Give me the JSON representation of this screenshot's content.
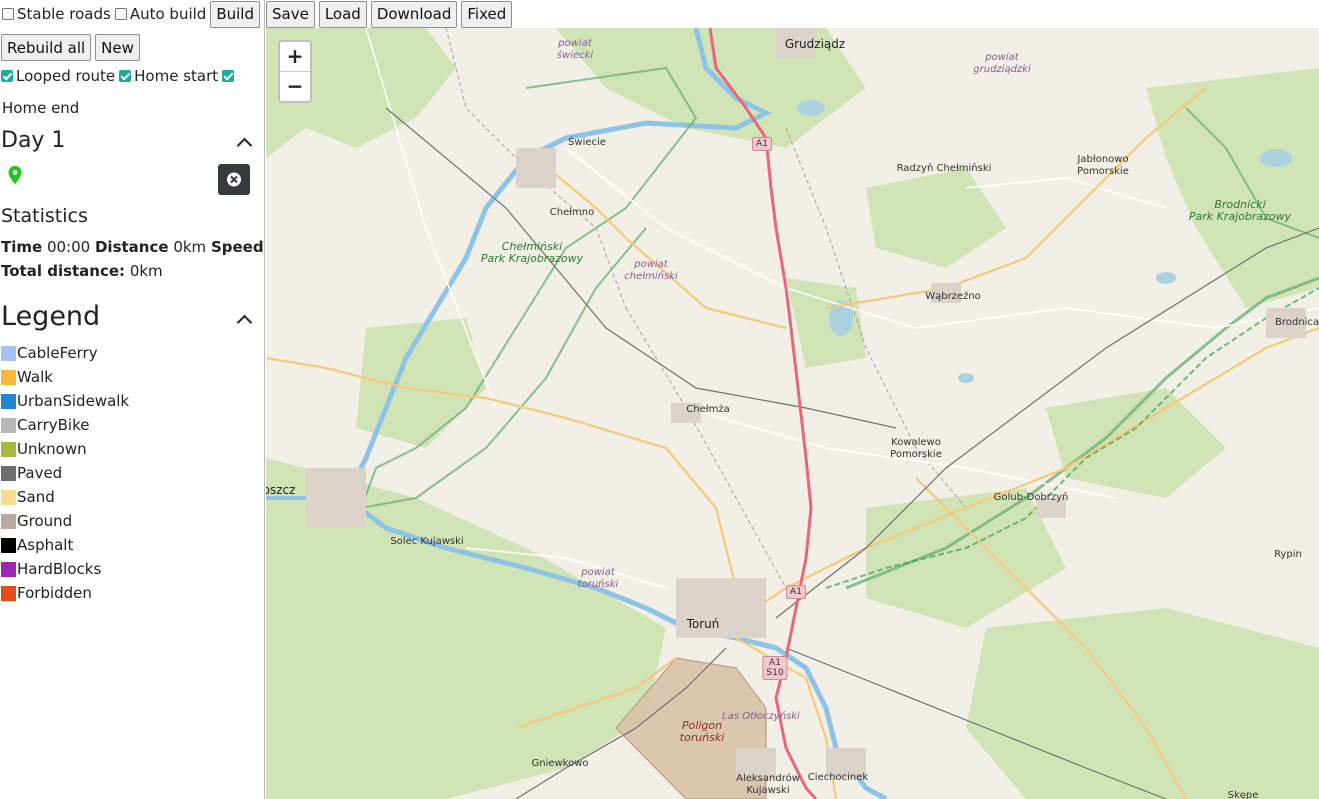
{
  "toolbar": {
    "stable_roads": "Stable roads",
    "auto_build": "Auto build",
    "build": "Build",
    "save": "Save",
    "load": "Load",
    "download": "Download",
    "fixed": "Fixed",
    "rebuild_all": "Rebuild all",
    "new": "New"
  },
  "options": {
    "looped_route": "Looped route",
    "home_start": "Home start",
    "home_end": "Home end"
  },
  "day": {
    "title": "Day 1"
  },
  "statistics": {
    "title": "Statistics",
    "time_label": "Time",
    "time_value": "00:00",
    "distance_label": "Distance",
    "distance_value": "0km",
    "speed_label": "Speed",
    "speed_value": "--",
    "total_label": "Total distance:",
    "total_value": "0km"
  },
  "legend": {
    "title": "Legend",
    "items": [
      {
        "label": "CableFerry",
        "color": "#a4c2f4"
      },
      {
        "label": "Walk",
        "color": "#f6b93b"
      },
      {
        "label": "UrbanSidewalk",
        "color": "#1e88d0"
      },
      {
        "label": "CarryBike",
        "color": "#b8b8b8"
      },
      {
        "label": "Unknown",
        "color": "#a9b93a"
      },
      {
        "label": "Paved",
        "color": "#6e6e6e"
      },
      {
        "label": "Sand",
        "color": "#f8dc8c"
      },
      {
        "label": "Ground",
        "color": "#bba89f"
      },
      {
        "label": "Asphalt",
        "color": "#000000"
      },
      {
        "label": "HardBlocks",
        "color": "#9c27b0"
      },
      {
        "label": "Forbidden",
        "color": "#e64a19"
      }
    ]
  },
  "map": {
    "zoom_in": "+",
    "zoom_out": "−",
    "labels": {
      "grudziadz": "Grudziądz",
      "powiat_swiecki": "powiat\nświecki",
      "powiat_grudziadzki": "powiat\ngrudziądzki",
      "swiecie": "Świecie",
      "radzyn": "Radzyń Chełmiński",
      "jablonowo": "Jabłonowo\nPomorskie",
      "brodnicki": "Brodnicki\nPark Krajobrazowy",
      "chelmno": "Chełmno",
      "chelminski_park": "Chełmiński\nPark Krajobrazowy",
      "powiat_chelminski": "powiat\nchełmiński",
      "wabrzezno": "Wąbrzeźno",
      "brodnica": "Brodnica",
      "chelmza": "Chełmża",
      "kowalewo": "Kowalewo\nPomorskie",
      "golub": "Golub-Dobrzyń",
      "bydgoszcz": "oszcz",
      "solec": "Solec Kujawski",
      "rypin": "Rypin",
      "powiat_torunski": "powiat\ntoruński",
      "torun": "Toruń",
      "las_otloczynski": "Las Otłoczyński",
      "poligon": "Poligon\ntoruński",
      "gniewkowo": "Gniewkowo",
      "aleksandrow": "Aleksandrów\nKujawski",
      "ciechocinek": "Ciechocinek",
      "skepe": "Skępe"
    },
    "shields": {
      "a1_north": "A1",
      "a1_mid": "A1",
      "a1_s10": "A1\nS10"
    }
  }
}
